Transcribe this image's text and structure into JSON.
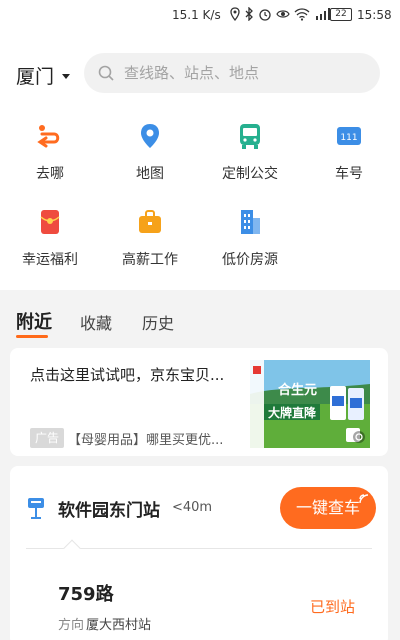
{
  "status_bar": {
    "speed": "15.1 K/s",
    "battery": "22",
    "time": "15:58"
  },
  "header": {
    "city": "厦门",
    "search_placeholder": "查线路、站点、地点"
  },
  "grid": [
    {
      "label": "去哪",
      "icon": "route-icon"
    },
    {
      "label": "地图",
      "icon": "map-pin-icon"
    },
    {
      "label": "定制公交",
      "icon": "bus-icon"
    },
    {
      "label": "车号",
      "icon": "bus-number-icon",
      "icon_text": "111"
    },
    {
      "label": "幸运福利",
      "icon": "red-envelope-icon"
    },
    {
      "label": "高薪工作",
      "icon": "briefcase-icon"
    },
    {
      "label": "低价房源",
      "icon": "building-icon"
    }
  ],
  "tabs": [
    {
      "label": "附近"
    },
    {
      "label": "收藏"
    },
    {
      "label": "历史"
    }
  ],
  "ad": {
    "title": "点击这里试试吧，京东宝贝...",
    "badge": "广告",
    "subtitle": "【母婴用品】哪里买更优...",
    "image_text_1": "合生元",
    "image_text_2": "大牌直降"
  },
  "station": {
    "name": "软件园东门站",
    "distance": "<40m",
    "check_button": "一键查车",
    "route": "759路",
    "direction_label": "方向",
    "direction": "厦大西村站",
    "arrival_status": "已到站"
  },
  "colors": {
    "accent": "#ff6b1f",
    "blue": "#3c8ee6",
    "teal": "#26b08f"
  }
}
